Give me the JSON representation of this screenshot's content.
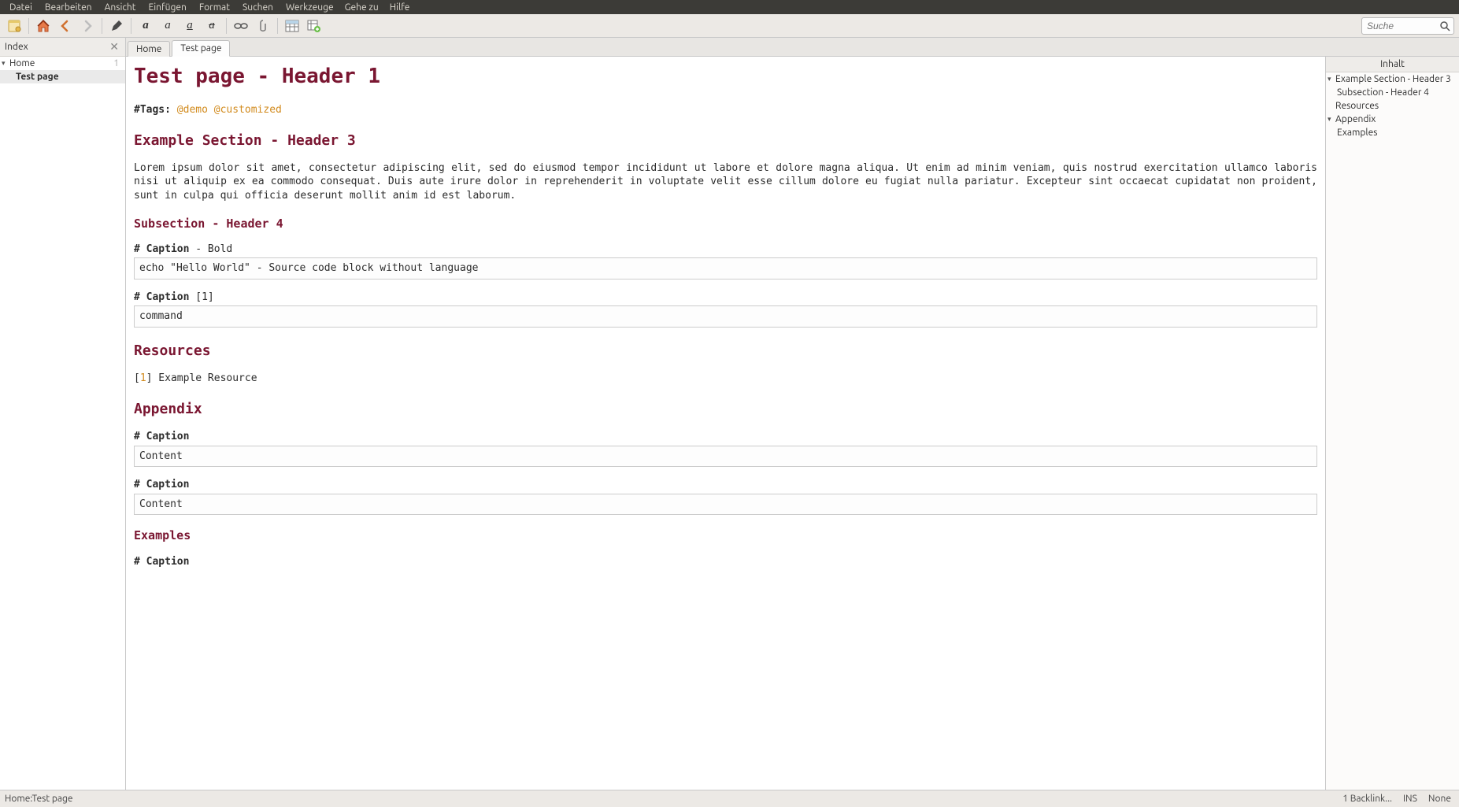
{
  "menubar": [
    "Datei",
    "Bearbeiten",
    "Ansicht",
    "Einfügen",
    "Format",
    "Suchen",
    "Werkzeuge",
    "Gehe zu",
    "Hilfe"
  ],
  "search": {
    "placeholder": "Suche"
  },
  "sidebar": {
    "title": "Index",
    "items": [
      {
        "label": "Home",
        "count": "1",
        "level": 0,
        "expandable": true
      },
      {
        "label": "Test page",
        "level": 1
      }
    ]
  },
  "tabs": [
    {
      "label": "Home",
      "active": false
    },
    {
      "label": "Test page",
      "active": true
    }
  ],
  "page": {
    "h1": "Test page - Header 1",
    "tags_label": "#Tags:",
    "tags": [
      "@demo",
      "@customized"
    ],
    "h3_example": "Example Section - Header 3",
    "lorem": "Lorem ipsum dolor sit amet, consectetur adipiscing elit, sed do eiusmod tempor incididunt ut labore et dolore magna aliqua. Ut enim ad minim veniam, quis nostrud exercitation ullamco laboris nisi ut aliquip ex ea commodo consequat. Duis aute irure dolor in reprehenderit in voluptate velit esse cillum dolore eu fugiat nulla pariatur. Excepteur sint occaecat cupidatat non proident, sunt in culpa qui officia deserunt mollit anim id est laborum.",
    "h4_sub": "Subsection - Header 4",
    "cap1_bold": "# Caption",
    "cap1_rest": " - Bold",
    "code1": "echo \"Hello World\" - Source code block without language",
    "cap2_bold": "# Caption",
    "cap2_rest": " [1]",
    "code2": "command",
    "h3_resources": "Resources",
    "res_open": "[",
    "res_num": "1",
    "res_close": "] Example Resource",
    "h3_appendix": "Appendix",
    "cap_app1": "# Caption",
    "code_app1": "Content",
    "cap_app2": "# Caption",
    "code_app2": "Content",
    "h4_examples": "Examples",
    "cap_ex": "# Caption"
  },
  "toc": {
    "title": "Inhalt",
    "items": [
      {
        "label": "Example Section - Header 3",
        "level": 0,
        "expandable": true
      },
      {
        "label": "Subsection - Header 4",
        "level": 1
      },
      {
        "label": "Resources",
        "level": 0,
        "expandable": false
      },
      {
        "label": "Appendix",
        "level": 0,
        "expandable": true
      },
      {
        "label": "Examples",
        "level": 1
      }
    ]
  },
  "statusbar": {
    "path": "Home:Test page",
    "backlinks": "1 Backlink...",
    "mode": "INS",
    "right": "None"
  }
}
